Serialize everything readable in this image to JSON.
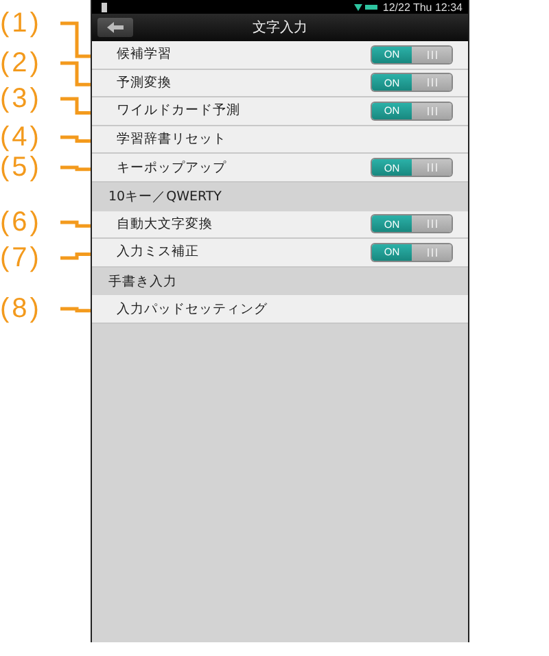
{
  "status_bar": {
    "time": "12/22 Thu 12:34"
  },
  "title_bar": {
    "title": "文字入力"
  },
  "items": [
    {
      "kind": "toggle",
      "label": "候補学習",
      "callout": "(1)",
      "on": true,
      "switch_text": "ON"
    },
    {
      "kind": "toggle",
      "label": "予測変換",
      "callout": "(2)",
      "on": true,
      "switch_text": "ON"
    },
    {
      "kind": "toggle",
      "label": "ワイルドカード予測",
      "callout": "(3)",
      "on": true,
      "switch_text": "ON"
    },
    {
      "kind": "action",
      "label": "学習辞書リセット",
      "callout": "(4)"
    },
    {
      "kind": "toggle",
      "label": "キーポップアップ",
      "callout": "(5)",
      "on": true,
      "switch_text": "ON"
    },
    {
      "kind": "section",
      "label": "10キー／QWERTY"
    },
    {
      "kind": "toggle",
      "label": "自動大文字変換",
      "callout": "(6)",
      "on": true,
      "switch_text": "ON"
    },
    {
      "kind": "toggle",
      "label": "入力ミス補正",
      "callout": "(7)",
      "on": true,
      "switch_text": "ON"
    },
    {
      "kind": "section",
      "label": "手書き入力"
    },
    {
      "kind": "action",
      "label": "入力パッドセッティング",
      "callout": "(8)"
    }
  ]
}
